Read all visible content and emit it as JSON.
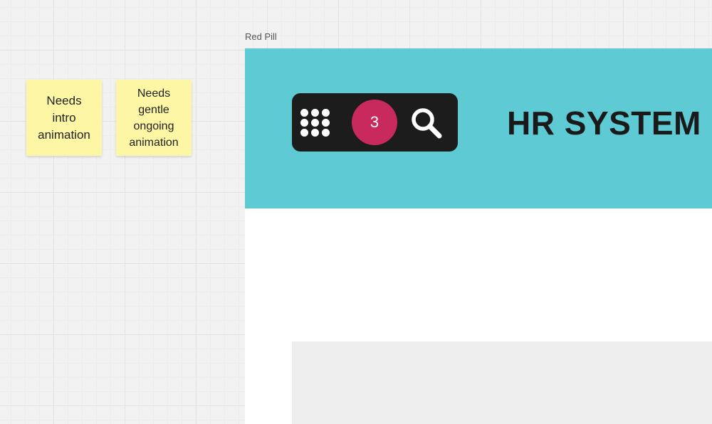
{
  "sticky_notes": [
    {
      "text": "Needs\nintro\nanimation"
    },
    {
      "text": "Needs\ngentle\nongoing\nanimation"
    }
  ],
  "frame": {
    "label": "Red Pill",
    "header": {
      "background_color": "#5ecad3",
      "title": "HR SYSTEM",
      "pill": {
        "apps_icon": "apps-grid-icon",
        "badge_count": "3",
        "badge_color": "#c92a5d",
        "search_icon": "search-icon"
      }
    }
  }
}
